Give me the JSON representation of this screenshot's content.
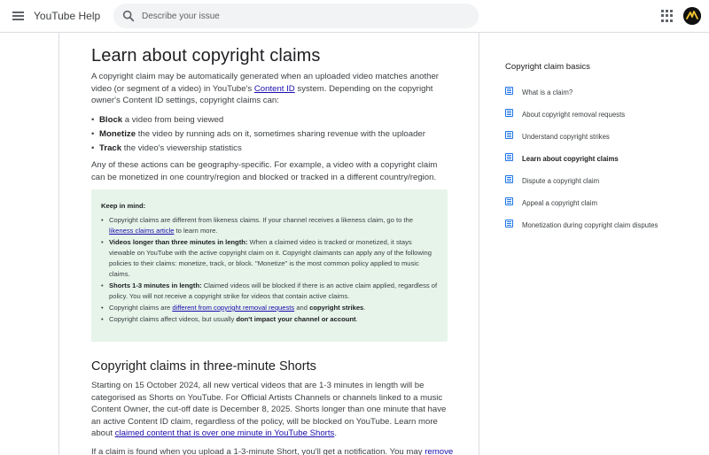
{
  "header": {
    "app_title": "YouTube Help",
    "search_placeholder": "Describe your issue"
  },
  "article": {
    "title": "Learn about copyright claims",
    "intro_part1": "A copyright claim may be automatically generated when an uploaded video matches another video (or segment of a video) in YouTube's ",
    "intro_link": "Content ID",
    "intro_part2": " system. Depending on the copyright owner's Content ID settings, copyright claims can:",
    "actions": [
      {
        "bold": "Block",
        "text": " a video from being viewed"
      },
      {
        "bold": "Monetize",
        "text": " the video by running ads on it, sometimes sharing revenue with the uploader"
      },
      {
        "bold": "Track",
        "text": " the video's viewership statistics"
      }
    ],
    "geo_text": "Any of these actions can be geography-specific. For example, a video with a copyright claim can be monetized in one country/region and blocked or tracked in a different country/region.",
    "keep_in_mind": {
      "title": "Keep in mind:",
      "item1_text": "Copyright claims are different from likeness claims. If your channel receives a likeness claim, go to the ",
      "item1_link": "likeness claims article",
      "item1_tail": " to learn more.",
      "item2_bold": "Videos longer than three minutes in length:",
      "item2_text": " When a claimed video is tracked or monetized, it stays viewable on YouTube with the active copyright claim on it. Copyright claimants can apply any of the following policies to their claims: monetize, track, or block. \"Monetize\" is the most common policy applied to music claims.",
      "item3_bold": "Shorts 1-3 minutes in length:",
      "item3_text": " Claimed videos will be blocked if there is an active claim applied, regardless of policy. You will not receive a copyright strike for videos that contain active claims.",
      "item4_pre": "Copyright claims are ",
      "item4_link": "different from copyright removal requests",
      "item4_mid": " and ",
      "item4_bold": "copyright strikes",
      "item4_end": ".",
      "item5_pre": "Copyright claims affect videos, but usually ",
      "item5_bold": "don't impact your channel or account",
      "item5_end": "."
    },
    "section_title": "Copyright claims in three-minute Shorts",
    "shorts_text": "Starting on 15 October 2024, all new vertical videos that are 1-3 minutes in length will be categorised as Shorts on YouTube. For Official Artists Channels or channels linked to a music Content Owner, the cut-off date is December 8, 2025. Shorts longer than one minute that have an active Content ID claim, regardless of the policy, will be blocked on YouTube. Learn more about ",
    "shorts_link": "claimed content that is over one minute in YouTube Shorts",
    "shorts_end": ".",
    "cut_text": "If a claim is found when you upload a 1-3-minute Short, you'll get a notification. You may ",
    "cut_link": "remove"
  },
  "sidebar": {
    "title": "Copyright claim basics",
    "items": [
      {
        "label": "What is a claim?"
      },
      {
        "label": "About copyright removal requests"
      },
      {
        "label": "Understand copyright strikes"
      },
      {
        "label": "Learn about copyright claims"
      },
      {
        "label": "Dispute a copyright claim"
      },
      {
        "label": "Appeal a copyright claim"
      },
      {
        "label": "Monetization during copyright claim disputes"
      }
    ]
  },
  "colors": {
    "link": "#1a0dab",
    "keep_box_bg": "#e6f4ea",
    "sidebar_icon": "#1a73e8"
  }
}
